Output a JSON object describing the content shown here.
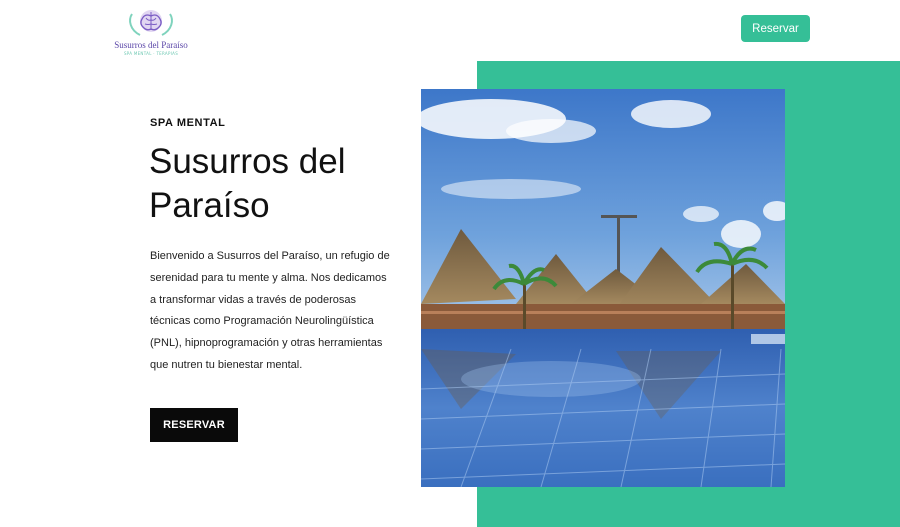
{
  "header": {
    "logo_title": "Susurros del Paraíso",
    "logo_subtitle": "SPA MENTAL · TERAPIAS",
    "reserve_button": "Reservar"
  },
  "hero": {
    "eyebrow": "SPA MENTAL",
    "title": "Susurros del Paraíso",
    "description": "Bienvenido a Susurros del Paraíso, un refugio de serenidad para tu mente y alma. Nos dedicamos a transformar vidas a través de poderosas técnicas como Programación Neurolingüística (PNL), hipnoprogramación y otras herramientas que nutren tu bienestar mental.",
    "cta_button": "RESERVAR"
  },
  "colors": {
    "accent": "#35bf97",
    "cta": "#0a0a0a",
    "brand_purple": "#5b46a8"
  },
  "icons": {
    "logo": "brain-hands-icon"
  }
}
